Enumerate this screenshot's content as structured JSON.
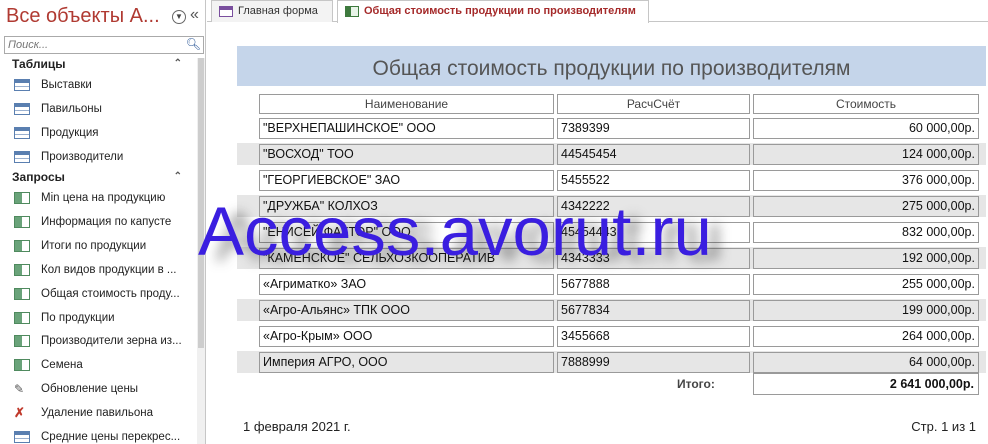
{
  "nav": {
    "title": "Все объекты А...",
    "search_placeholder": "Поиск...",
    "groups": [
      {
        "label": "Таблицы",
        "items": [
          {
            "label": "Выставки",
            "icon": "table-icon"
          },
          {
            "label": "Павильоны",
            "icon": "table-icon"
          },
          {
            "label": "Продукция",
            "icon": "table-icon"
          },
          {
            "label": "Производители",
            "icon": "table-icon"
          }
        ]
      },
      {
        "label": "Запросы",
        "items": [
          {
            "label": "Min цена на продукцию",
            "icon": "query-icon"
          },
          {
            "label": "Информация по капусте",
            "icon": "query-icon"
          },
          {
            "label": "Итоги по продукции",
            "icon": "query-icon"
          },
          {
            "label": "Кол видов продукции в ...",
            "icon": "query-icon"
          },
          {
            "label": "Общая стоимость проду...",
            "icon": "query-icon"
          },
          {
            "label": "По продукции",
            "icon": "query-icon"
          },
          {
            "label": "Производители зерна из...",
            "icon": "query-icon"
          },
          {
            "label": "Семена",
            "icon": "query-icon"
          },
          {
            "label": "Обновление цены",
            "icon": "update-query-icon"
          },
          {
            "label": "Удаление павильона",
            "icon": "delete-query-icon"
          },
          {
            "label": "Средние цены перекрес...",
            "icon": "crosstab-query-icon"
          }
        ]
      }
    ]
  },
  "tabs": [
    {
      "label": "Главная форма",
      "active": false
    },
    {
      "label": "Общая стоимость продукции по производителям",
      "active": true
    }
  ],
  "report": {
    "title": "Общая стоимость продукции по производителям",
    "columns": [
      "Наименование",
      "РасчСчёт",
      "Стоимость"
    ],
    "rows": [
      [
        "\"ВЕРХНЕПАШИНСКОЕ\" ООО",
        "7389399",
        "60 000,00р."
      ],
      [
        "\"ВОСХОД\" ТОО",
        "44545454",
        "124 000,00р."
      ],
      [
        "\"ГЕОРГИЕВСКОЕ\" ЗАО",
        "5455522",
        "376 000,00р."
      ],
      [
        "\"ДРУЖБА\" КОЛХОЗ",
        "4342222",
        "275 000,00р."
      ],
      [
        "\"ЕНИСЕЙ ФАКТОР\" ООО",
        "45454443",
        "832 000,00р."
      ],
      [
        "\"КАМЕНСКОЕ\" СЕЛЬХОЗКООПЕРАТИВ",
        "4343333",
        "192 000,00р."
      ],
      [
        "«Агриматко» ЗАО",
        "5677888",
        "255 000,00р."
      ],
      [
        "«Агро-Альянс» ТПК ООО",
        "5677834",
        "199 000,00р."
      ],
      [
        "«Агро-Крым» ООО",
        "3455668",
        "264 000,00р."
      ],
      [
        "Империя АГРО, ООО",
        "7888999",
        "64 000,00р."
      ]
    ],
    "total_label": "Итого:",
    "total_value": "2 641 000,00р.",
    "footer_date": "1 февраля 2021 г.",
    "footer_page": "Стр. 1 из 1"
  },
  "watermark": "Access.avorut.ru",
  "colors": {
    "title_band": "#c5d5ea",
    "nav_title": "#b03a32",
    "watermark": "#3a1ee0"
  }
}
